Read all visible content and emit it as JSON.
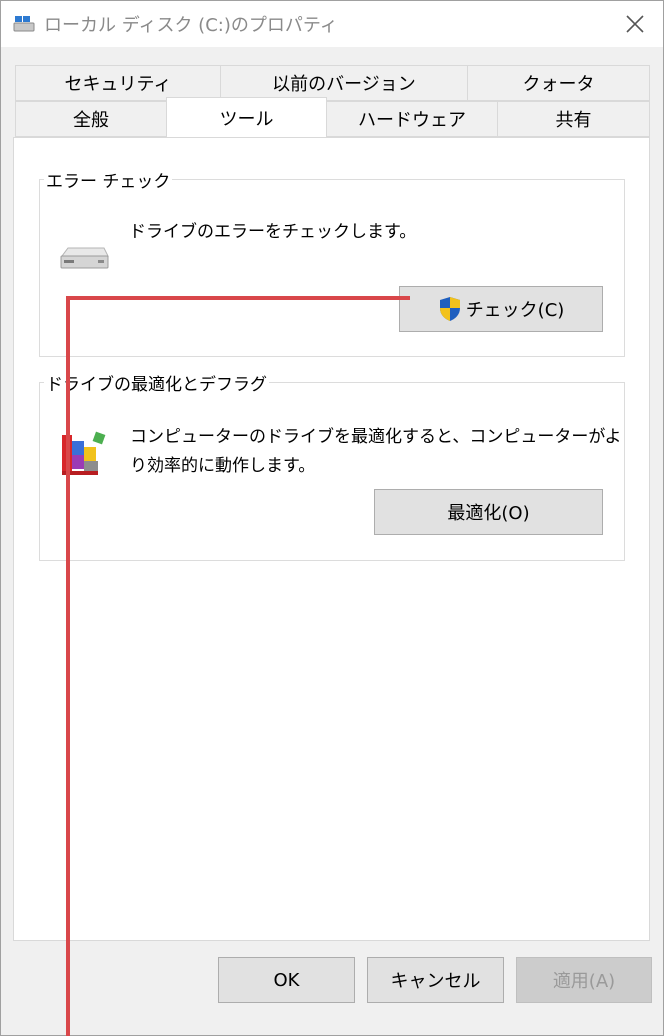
{
  "window": {
    "title": "ローカル ディスク (C:)のプロパティ"
  },
  "tabs": {
    "row1": [
      {
        "label": "セキュリティ"
      },
      {
        "label": "以前のバージョン"
      },
      {
        "label": "クォータ"
      }
    ],
    "row2": [
      {
        "label": "全般"
      },
      {
        "label": "ツール"
      },
      {
        "label": "ハードウェア"
      },
      {
        "label": "共有"
      }
    ],
    "active": "ツール"
  },
  "error_check": {
    "title": "エラー チェック",
    "description": "ドライブのエラーをチェックします。",
    "button_label": "チェック(C)"
  },
  "optimize": {
    "title": "ドライブの最適化とデフラグ",
    "description_line1": "コンピューターのドライブを最適化すると、コンピューターがよ",
    "description_line2": "り効率的に動作します。",
    "button_label": "最適化(O)"
  },
  "footer": {
    "ok_label": "OK",
    "cancel_label": "キャンセル",
    "apply_label": "適用(A)"
  },
  "colors": {
    "annotation": "#d9474a",
    "shield_blue": "#1f5fbf",
    "shield_yellow": "#f2c21b"
  }
}
